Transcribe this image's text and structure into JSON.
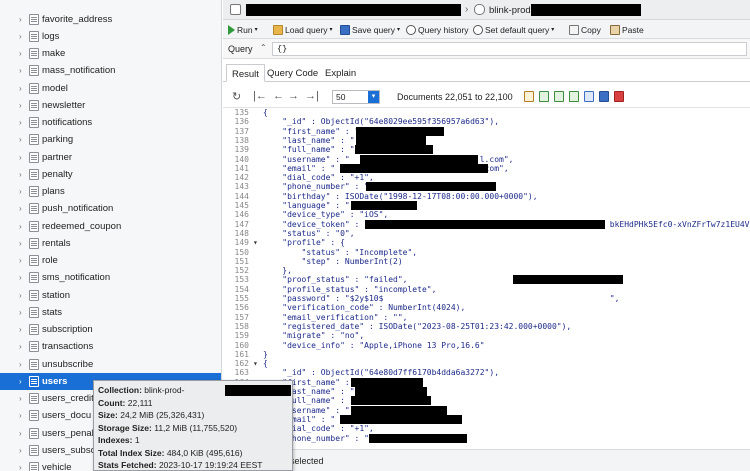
{
  "tree": {
    "items": [
      {
        "label": "favorite_address"
      },
      {
        "label": "logs"
      },
      {
        "label": "make"
      },
      {
        "label": "mass_notification"
      },
      {
        "label": "model"
      },
      {
        "label": "newsletter"
      },
      {
        "label": "notifications"
      },
      {
        "label": "parking"
      },
      {
        "label": "partner"
      },
      {
        "label": "penalty"
      },
      {
        "label": "plans"
      },
      {
        "label": "push_notification"
      },
      {
        "label": "redeemed_coupon"
      },
      {
        "label": "rentals"
      },
      {
        "label": "role"
      },
      {
        "label": "sms_notification"
      },
      {
        "label": "station"
      },
      {
        "label": "stats"
      },
      {
        "label": "subscription"
      },
      {
        "label": "transactions"
      },
      {
        "label": "unsubscribe"
      },
      {
        "label": "users",
        "selected": true
      },
      {
        "label": "users_credit"
      },
      {
        "label": "users_docu"
      },
      {
        "label": "users_penalt"
      },
      {
        "label": "users_subsc"
      },
      {
        "label": "vehicle"
      }
    ]
  },
  "tooltip": {
    "collection_label": "Collection:",
    "collection_value": "blink-prod-",
    "count_label": "Count:",
    "count_value": "22,111",
    "size_label": "Size:",
    "size_value": "24,2 MiB  (25,326,431)",
    "storage_label": "Storage Size:",
    "storage_value": "11,2 MiB  (11,755,520)",
    "indexes_label": "Indexes:",
    "indexes_value": "1",
    "index_size_label": "Total Index Size:",
    "index_size_value": "484,0 KiB  (495,616)",
    "fetched_label": "Stats Fetched:",
    "fetched_value": "2023-10-17 19:19:24 EEST"
  },
  "titlebar": {
    "db_name": "blink-prod-"
  },
  "toolbar": {
    "run": "Run",
    "load_query": "Load query",
    "save_query": "Save query",
    "query_history": "Query history",
    "set_default_query": "Set default query",
    "copy": "Copy",
    "paste": "Paste"
  },
  "query": {
    "label": "Query",
    "value": "{}"
  },
  "tabs": [
    {
      "label": "Result"
    },
    {
      "label": "Query Code"
    },
    {
      "label": "Explain"
    }
  ],
  "paging": {
    "page_size": "50",
    "status": "Documents 22,051 to 22,100"
  },
  "code_lines": [
    {
      "n": "135",
      "fold": "",
      "t": "{"
    },
    {
      "n": "136",
      "fold": "",
      "t": "    \"_id\" : ObjectId(\"64e8029ee595f356957a6d63\"),"
    },
    {
      "n": "137",
      "fold": "",
      "t": "    \"first_name\" : \""
    },
    {
      "n": "138",
      "fold": "",
      "t": "    \"last_name\" : \""
    },
    {
      "n": "139",
      "fold": "",
      "t": "    \"full_name\" : \""
    },
    {
      "n": "140",
      "fold": "",
      "t": "    \"username\" : \"                           l.com\","
    },
    {
      "n": "141",
      "fold": "",
      "t": "    \"email\" : \"                             l.com\","
    },
    {
      "n": "142",
      "fold": "",
      "t": "    \"dial_code\" : \"+1\","
    },
    {
      "n": "143",
      "fold": "",
      "t": "    \"phone_number\" : \""
    },
    {
      "n": "144",
      "fold": "",
      "t": "    \"birthday\" : ISODate(\"1998-12-17T08:00:00.000+0000\"),"
    },
    {
      "n": "145",
      "fold": "",
      "t": "    \"language\" : \""
    },
    {
      "n": "146",
      "fold": "",
      "t": "    \"device_type\" : \"iOS\","
    },
    {
      "n": "147",
      "fold": "",
      "t": "    \"device_token\" : \"                                                  bkEHdPHk5Efc0-xVnZFrTw7z1EU4V"
    },
    {
      "n": "148",
      "fold": "",
      "t": "    \"status\" : \"0\","
    },
    {
      "n": "149",
      "fold": "▾",
      "t": "    \"profile\" : {"
    },
    {
      "n": "150",
      "fold": "",
      "t": "        \"status\" : \"Incomplete\","
    },
    {
      "n": "151",
      "fold": "",
      "t": "        \"step\" : NumberInt(2)"
    },
    {
      "n": "152",
      "fold": "",
      "t": "    },"
    },
    {
      "n": "153",
      "fold": "",
      "t": "    \"proof_status\" : \"failed\","
    },
    {
      "n": "154",
      "fold": "",
      "t": "    \"profile_status\" : \"incomplete\","
    },
    {
      "n": "155",
      "fold": "",
      "t": "    \"password\" : \"$2y$10$                                               \","
    },
    {
      "n": "156",
      "fold": "",
      "t": "    \"verification_code\" : NumberInt(4024),"
    },
    {
      "n": "157",
      "fold": "",
      "t": "    \"email_verification\" : \"\","
    },
    {
      "n": "158",
      "fold": "",
      "t": "    \"registered_date\" : ISODate(\"2023-08-25T01:23:42.000+0000\"),"
    },
    {
      "n": "159",
      "fold": "",
      "t": "    \"migrate\" : \"no\","
    },
    {
      "n": "160",
      "fold": "",
      "t": "    \"device_info\" : \"Apple,iPhone 13 Pro,16.6\""
    },
    {
      "n": "161",
      "fold": "",
      "t": "}"
    },
    {
      "n": "162",
      "fold": "▾",
      "t": "{"
    },
    {
      "n": "163",
      "fold": "",
      "t": "    \"_id\" : ObjectId(\"64e80d7ff6170b4dda6a3272\"),"
    },
    {
      "n": "164",
      "fold": "",
      "t": "    \"first_name\" : \""
    },
    {
      "n": "165",
      "fold": "",
      "t": "    \"last_name\" : \""
    },
    {
      "n": "166",
      "fold": "",
      "t": "    \"full_name\" : \""
    },
    {
      "n": "167",
      "fold": "",
      "t": "    \"username\" : \""
    },
    {
      "n": "168",
      "fold": "",
      "t": "    \"email\" : \""
    },
    {
      "n": "169",
      "fold": "",
      "t": "    \"dial_code\" : \"+1\","
    },
    {
      "n": "170",
      "fold": "",
      "t": "    \"phone_number\" : \""
    }
  ],
  "statusbar": {
    "text": "t selected"
  }
}
